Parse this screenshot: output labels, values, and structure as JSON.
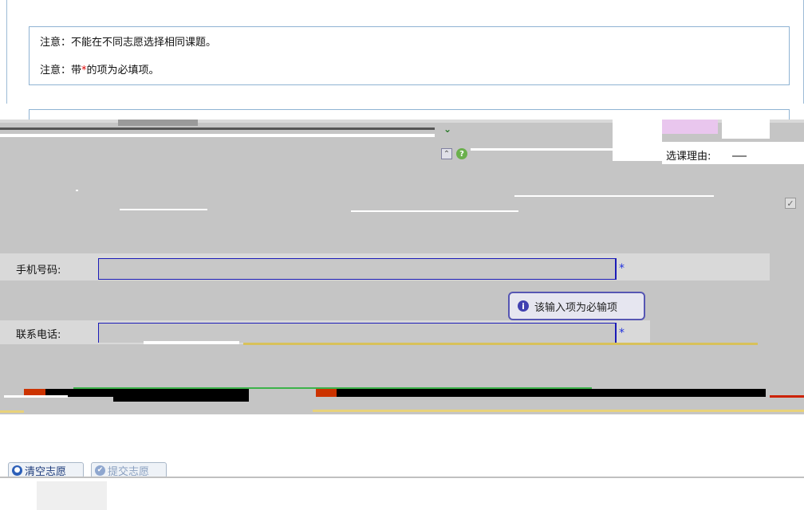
{
  "notice": {
    "line1": "注意：不能在不同志愿选择相同课题。",
    "line2_prefix": "注意：带",
    "line2_star": "*",
    "line2_suffix": "的项为必填项。"
  },
  "form": {
    "reason_label": "选课理由:",
    "phone_label": "手机号码:",
    "phone_value": "",
    "contact_label": "联系电话:",
    "contact_value": "",
    "required_mark": "*",
    "tooltip_text": "该输入项为必输项"
  },
  "buttons": {
    "clear_label": "清空志愿",
    "submit_label": "提交志愿"
  },
  "colors": {
    "accent": "#1b1bb8",
    "required": "#e00000",
    "panel_border": "#8fb3d3"
  },
  "icons": {
    "dropdown": "chevron-down-icon",
    "scroll_up": "chevron-up-icon",
    "help": "help-icon",
    "info": "info-icon",
    "checkbox": "checkbox-icon",
    "clear": "clear-icon",
    "submit": "submit-icon"
  }
}
